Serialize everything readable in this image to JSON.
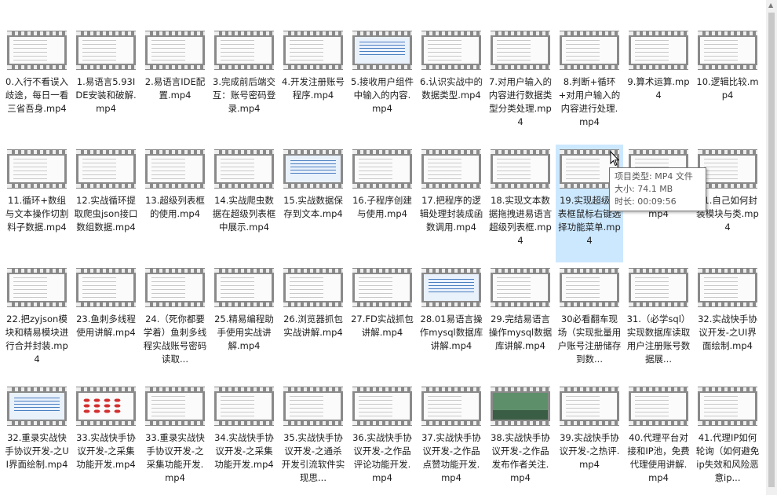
{
  "files": [
    {
      "name": "0.入行不看误入歧途，每日一看三省吾身.mp4",
      "thumb": "lines"
    },
    {
      "name": "1.易语言5.93IDE安装和破解.mp4",
      "thumb": "lines"
    },
    {
      "name": "2.易语言IDE配置.mp4",
      "thumb": "lines"
    },
    {
      "name": "3.完成前后端交互：账号密码登录.mp4",
      "thumb": "lines"
    },
    {
      "name": "4.开发注册账号程序.mp4",
      "thumb": "lines"
    },
    {
      "name": "5.接收用户组件中输入的内容.mp4",
      "thumb": "blue"
    },
    {
      "name": "6.认识实战中的数据类型.mp4",
      "thumb": "lines"
    },
    {
      "name": "7.对用户输入的内容进行数据类型分类处理.mp4",
      "thumb": "lines"
    },
    {
      "name": "8.判断+循环+对用户输入的内容进行处理.mp4",
      "thumb": "lines"
    },
    {
      "name": "9.算术运算.mp4",
      "thumb": "lines"
    },
    {
      "name": "10.逻辑比较.mp4",
      "thumb": "lines"
    },
    {
      "name": "11.循环+数组与文本操作切割料子数据.mp4",
      "thumb": "lines"
    },
    {
      "name": "12.实战循环提取爬虫json接口数组数据.mp4",
      "thumb": "lines"
    },
    {
      "name": "13.超级列表框的使用.mp4",
      "thumb": "lines"
    },
    {
      "name": "14.实战爬虫数据在超级列表框中展示.mp4",
      "thumb": "lines"
    },
    {
      "name": "15.实战数据保存到文本.mp4",
      "thumb": "blue"
    },
    {
      "name": "16.子程序创建与使用.mp4",
      "thumb": "lines"
    },
    {
      "name": "17.把程序的逻辑处理封装成函数调用.mp4",
      "thumb": "lines"
    },
    {
      "name": "18.实现文本数据拖拽进易语言超级列表框.mp4",
      "thumb": "lines"
    },
    {
      "name": "19.实现超级列表框鼠标右键选择功能菜单.mp4",
      "thumb": "lines",
      "selected": true
    },
    {
      "name": "20.模块的使用.mp4",
      "thumb": "lines"
    },
    {
      "name": "21.自己如何封装模块与类.mp4",
      "thumb": "lines"
    },
    {
      "name": "22.把zyjson模块和精易模块进行合并封装.mp4",
      "thumb": "lines"
    },
    {
      "name": "23.鱼刺多线程使用讲解.mp4",
      "thumb": "lines"
    },
    {
      "name": "24.（死你都要学着）鱼刺多线程实战账号密码读取...",
      "thumb": "lines"
    },
    {
      "name": "25.精易编程助手使用实战讲解.mp4",
      "thumb": "lines"
    },
    {
      "name": "26.浏览器抓包实战讲解.mp4",
      "thumb": "lines"
    },
    {
      "name": "27.FD实战抓包讲解.mp4",
      "thumb": "lines"
    },
    {
      "name": "28.01易语言操作mysql数据库讲解.mp4",
      "thumb": "blue"
    },
    {
      "name": "29.完结易语言操作mysql数据库讲解.mp4",
      "thumb": "lines"
    },
    {
      "name": "30必看翻车现场（实现批量用户账号注册储存到数...",
      "thumb": "lines"
    },
    {
      "name": "31.（必学sql）实现数据库读取用户注册账号数据展...",
      "thumb": "lines"
    },
    {
      "name": "32.实战快手协议开发-之UI界面绘制.mp4",
      "thumb": "lines"
    },
    {
      "name": "32.重录实战快手协议开发-之UI界面绘制.mp4",
      "thumb": "blue"
    },
    {
      "name": "33.实战快手协议开发-之采集功能开发.mp4",
      "thumb": "red"
    },
    {
      "name": "33.重录实战快手协议开发-之采集功能开发.mp4",
      "thumb": "lines"
    },
    {
      "name": "34.实战快手协议开发-之采集功能开发.mp4",
      "thumb": "lines"
    },
    {
      "name": "35.实战快手协议开发-之通杀开发引流软件实现思...",
      "thumb": "lines"
    },
    {
      "name": "36.实战快手协议开发-之作品评论功能开发.mp4",
      "thumb": "lines"
    },
    {
      "name": "37.实战快手协议开发-之作品点赞功能开发.mp4",
      "thumb": "lines"
    },
    {
      "name": "38.实战快手协议开发-之作品发布作者关注.mp4",
      "thumb": "photo"
    },
    {
      "name": "39.实战快手协议开发-之热评.mp4",
      "thumb": "lines"
    },
    {
      "name": "40.代理平台对接和IP池，免费代理使用讲解.mp4",
      "thumb": "lines"
    },
    {
      "name": "41.代理IP如何轮询（如何避免ip失效和风险恶意ip...",
      "thumb": "lines"
    }
  ],
  "tooltip": {
    "type": "项目类型: MP4 文件",
    "size": "大小: 74.1 MB",
    "duration": "时长: 00:09:56"
  },
  "colors": {
    "selection": "#cce8ff",
    "background": "#ffffff",
    "filmstrip": "#8a8a8a"
  }
}
